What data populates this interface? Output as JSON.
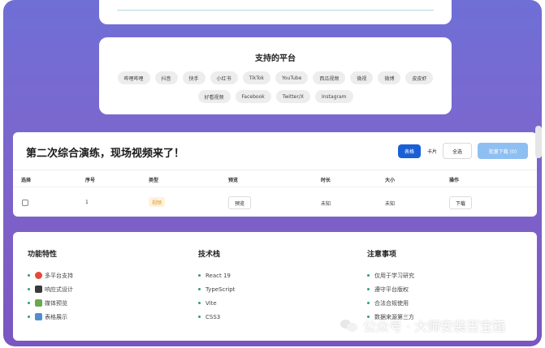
{
  "platforms": {
    "title": "支持的平台",
    "items": [
      "哔哩哔哩",
      "抖音",
      "快手",
      "小红书",
      "TikTok",
      "YouTube",
      "西瓜视频",
      "微视",
      "微博",
      "皮皮虾",
      "好看视频",
      "Facebook",
      "Twitter/X",
      "Instagram"
    ]
  },
  "list": {
    "title": "第二次综合演练，现场视频来了！",
    "view_table": "表格",
    "view_card": "卡片",
    "select_all": "全选",
    "batch_download": "批量下载 (0)",
    "columns": [
      "选择",
      "序号",
      "类型",
      "预览",
      "时长",
      "大小",
      "操作"
    ],
    "row": {
      "index": "1",
      "type": "视频",
      "preview": "预览",
      "duration": "未知",
      "size": "未知",
      "action": "下载"
    }
  },
  "features": {
    "col1": {
      "title": "功能特性",
      "items": [
        "多平台支持",
        "响应式设计",
        "媒体预览",
        "表格展示"
      ]
    },
    "col2": {
      "title": "技术栈",
      "items": [
        "React 19",
        "TypeScript",
        "Vite",
        "CSS3"
      ]
    },
    "col3": {
      "title": "注意事项",
      "items": [
        "仅用于学习研究",
        "遵守平台版权",
        "合法合规使用",
        "数据来源第三方"
      ]
    }
  },
  "watermark": "公众号 · 大师安装百宝箱"
}
